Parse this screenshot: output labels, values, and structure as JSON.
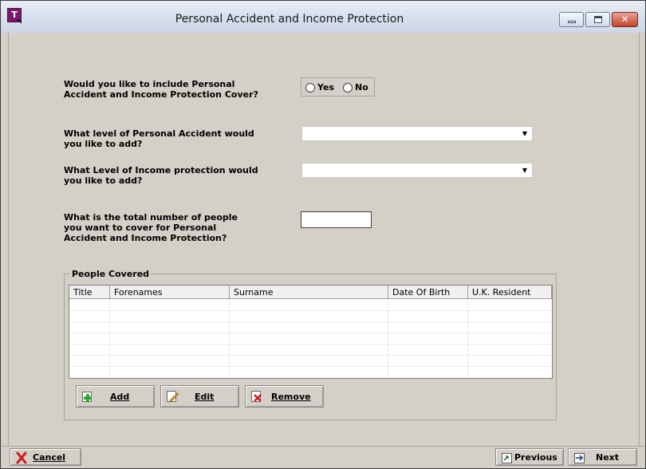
{
  "window": {
    "title": "Personal Accident and Income Protection",
    "app_icon_letter": "T"
  },
  "questions": {
    "include_cover": "Would you like to include Personal Accident and Income Protection Cover?",
    "pa_level": "What level of Personal Accident would you like to add?",
    "ip_level": "What Level of Income protection would you like to add?",
    "people_count": "What is the total number of people you want to cover for Personal Accident and Income Protection?"
  },
  "include_cover_options": {
    "yes_label": "Yes",
    "no_label": "No",
    "selected": null
  },
  "pa_level_select": {
    "value": "",
    "arrow": "▼"
  },
  "ip_level_select": {
    "value": "",
    "arrow": "▼"
  },
  "people_count_input": {
    "value": ""
  },
  "people_covered": {
    "title": "People Covered",
    "columns": [
      "Title",
      "Forenames",
      "Surname",
      "Date Of Birth",
      "U.K. Resident"
    ],
    "rows": []
  },
  "people_buttons": {
    "add": "Add",
    "edit": "Edit",
    "remove": "Remove"
  },
  "footer": {
    "cancel": "Cancel",
    "previous": "Previous",
    "next": "Next"
  },
  "colors": {
    "dialog_bg": "#d4d0c8",
    "app_icon": "#7a1a6c",
    "close_button": "#c4432c"
  }
}
